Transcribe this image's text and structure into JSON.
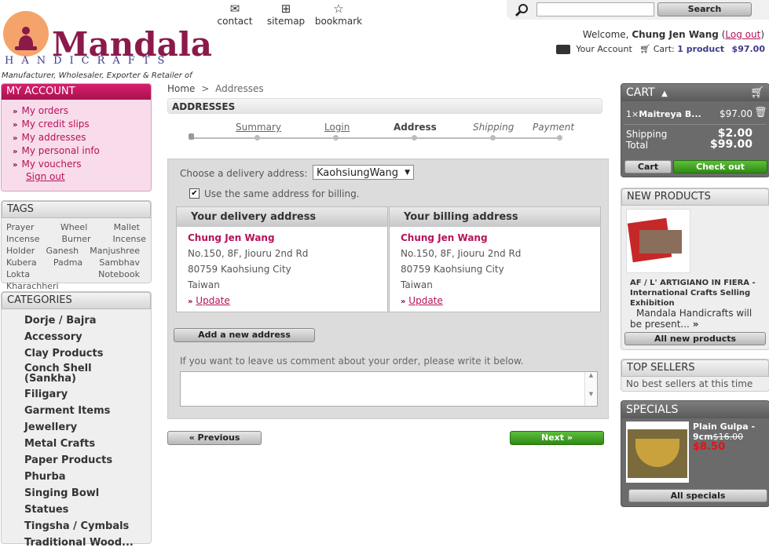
{
  "logo": {
    "word": "Mandala",
    "sub": "HANDICRAFTS",
    "tagline": "Manufacturer, Wholesaler, Exporter & Retailer of"
  },
  "topnav": [
    {
      "label": "contact",
      "icon": "envelope-icon"
    },
    {
      "label": "sitemap",
      "icon": "sitemap-icon"
    },
    {
      "label": "bookmark",
      "icon": "star-icon"
    }
  ],
  "search": {
    "button": "Search",
    "placeholder": ""
  },
  "welcome": {
    "prefix": "Welcome,",
    "name": "Chung Jen Wang",
    "logout": "Log out"
  },
  "account_bar": {
    "your_account": "Your Account",
    "cart_label": "Cart:",
    "cart_count": "1 product",
    "cart_total": "$97.00"
  },
  "my_account": {
    "title": "MY ACCOUNT",
    "items": [
      "My orders",
      "My credit slips",
      "My addresses",
      "My personal info",
      "My vouchers"
    ],
    "signout": "Sign out"
  },
  "tags": {
    "title": "TAGS",
    "items": [
      "Prayer",
      "Wheel",
      "Mallet",
      "Incense",
      "Burner",
      "Incense Holder",
      "Ganesh",
      "Manjushree",
      "Kubera",
      "Padma",
      "Sambhav",
      "Lokta",
      "Notebook",
      "Kharachheri"
    ]
  },
  "categories": {
    "title": "CATEGORIES",
    "items": [
      "Dorje / Bajra",
      "Accessory",
      "Clay Products",
      "Conch Shell (Sankha)",
      "Filigary",
      "Garment Items",
      "Jewellery",
      "Metal Crafts",
      "Paper Products",
      "Phurba",
      "Singing Bowl",
      "Statues",
      "Tingsha / Cymbals",
      "Traditional Wood..."
    ]
  },
  "breadcrumb": {
    "home": "Home",
    "sep": ">",
    "current": "Addresses"
  },
  "page_title": "ADDRESSES",
  "steps": [
    "Summary",
    "Login",
    "Address",
    "Shipping",
    "Payment"
  ],
  "address_form": {
    "choose_label": "Choose a delivery address:",
    "selected": "KaohsiungWang",
    "same_billing": "Use the same address for billing.",
    "delivery": {
      "title": "Your delivery address",
      "name": "Chung Jen Wang",
      "line1": "No.150, 8F, Jiouru 2nd Rd",
      "line2": "80759 Kaohsiung City",
      "country": "Taiwan",
      "update": "Update"
    },
    "billing": {
      "title": "Your billing address",
      "name": "Chung Jen Wang",
      "line1": "No.150, 8F, Jiouru 2nd Rd",
      "line2": "80759 Kaohsiung City",
      "country": "Taiwan",
      "update": "Update"
    },
    "add_new": "Add a new address",
    "comment_label": "If you want to leave us comment about your order, please write it below.",
    "comment_value": ""
  },
  "nav_buttons": {
    "previous": "« Previous",
    "next": "Next »"
  },
  "cart": {
    "title": "CART",
    "item_qty": "1×",
    "item_name": "Maitreya B...",
    "item_price": "$97.00",
    "shipping_label": "Shipping",
    "shipping_value": "$2.00",
    "total_label": "Total",
    "total_value": "$99.00",
    "cart_button": "Cart",
    "checkout_button": "Check out"
  },
  "new_products": {
    "title": "NEW PRODUCTS",
    "product_title": "AF / L' ARTIGIANO IN FIERA - International Crafts Selling Exhibition",
    "product_desc": "Mandala Handicrafts will be present...",
    "all_button": "All new products"
  },
  "top_sellers": {
    "title": "TOP SELLERS",
    "empty": "No best sellers at this time"
  },
  "specials": {
    "title": "SPECIALS",
    "name": "Plain Gulpa - 9cm",
    "old_price": "$16.00",
    "new_price": "$8.50",
    "all_button": "All specials"
  },
  "colors": {
    "brand": "#8b1a4a",
    "accent": "#b5125a",
    "green": "#3a9a1f"
  }
}
